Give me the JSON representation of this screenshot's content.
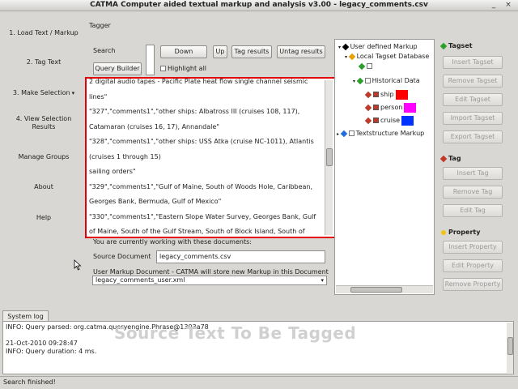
{
  "window": {
    "title": "CATMA Computer aided textual markup and analysis v3.00  -  legacy_comments.csv",
    "minimize_glyph": "_",
    "close_glyph": "×"
  },
  "sidebar": {
    "items": [
      {
        "label": "1. Load Text / Markup"
      },
      {
        "label": "2. Tag Text"
      },
      {
        "label": "3. Make Selection"
      },
      {
        "label": "4. View Selection"
      },
      {
        "label": "Results"
      },
      {
        "label": "Manage Groups"
      },
      {
        "label": "About"
      },
      {
        "label": "Help"
      }
    ],
    "selection_marker": "▾"
  },
  "tagger": {
    "title": "Tagger",
    "search_label": "Search",
    "query_builder": "Query Builder",
    "down": "Down",
    "up": "Up",
    "tag_results": "Tag results",
    "untag_results": "Untag results",
    "highlight_all": "Highlight all"
  },
  "text_panel": {
    "lines": [
      "2 digital audio tapes - Pacific Plate heat flow single channel seismic",
      "lines\"",
      "\"327\",\"comments1\",\"other ships: Albatross III (cruises 108, 117),",
      "Catamaran (cruises 16, 17), Annandale\"",
      "\"328\",\"comments1\",\"other ships: USS Atka (cruise NC-1011), Atlantis",
      "(cruises 1 through 15)",
      "sailing orders\"",
      "\"329\",\"comments1\",\"Gulf of Maine, South of Woods Hole, Caribbean,",
      "Georges Bank, Bermuda, Gulf of Mexico\"",
      "\"330\",\"comments1\",\"Eastern Slope Water Survey, Georges Bank, Gulf",
      "of Maine, South of the Gulf Stream, South of Block Island, South of"
    ]
  },
  "documents": {
    "working_label": "You are currently working with these documents:",
    "source_label": "Source Document",
    "source_value": "legacy_comments.csv",
    "user_markup_label": "User Markup Document - CATMA will store new Markup in this Document",
    "user_markup_value": "legacy_comments_user.xml"
  },
  "tree": {
    "rows": [
      {
        "label": "User defined Markup"
      },
      {
        "label": "Local Tagset Database"
      },
      {
        "label": "Historical Data"
      },
      {
        "label": "ship",
        "color": "#ff0000"
      },
      {
        "label": "person",
        "color": "#ff00ff"
      },
      {
        "label": "cruise",
        "color": "#0033ff"
      },
      {
        "label": "Textstructure Markup"
      }
    ]
  },
  "right_panel": {
    "tagset_title": "Tagset",
    "tagset_buttons": [
      "Insert Tagset",
      "Remove Tagset",
      "Edit Tagset",
      "Import Tagset",
      "Export Tagset"
    ],
    "tag_title": "Tag",
    "tag_buttons": [
      "Insert Tag",
      "Remove Tag",
      "Edit Tag"
    ],
    "property_title": "Property",
    "property_buttons": [
      "Insert Property",
      "Edit Property",
      "Remove Property"
    ]
  },
  "system_log": {
    "tab_label": "System log",
    "lines": [
      "INFO: Query parsed: org.catma.queryengine.Phrase@1303a78",
      "21-Oct-2010 09:28:47",
      "INFO: Query duration: 4 ms."
    ],
    "watermark": "Source Text To Be Tagged"
  },
  "status": {
    "text": "Search finished!"
  }
}
